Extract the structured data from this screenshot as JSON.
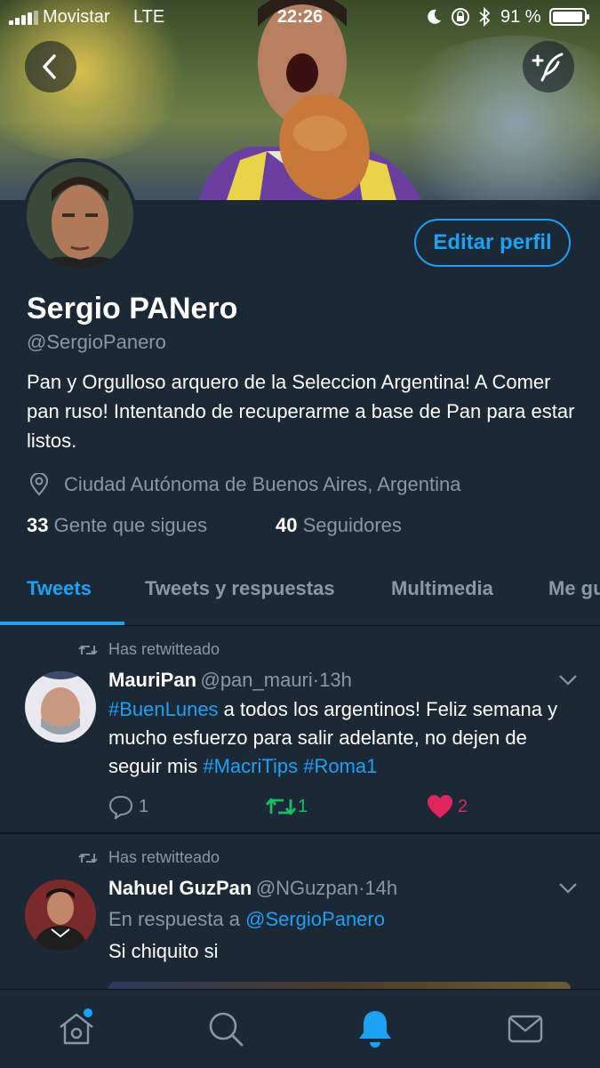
{
  "status_bar": {
    "carrier": "Movistar",
    "network": "LTE",
    "time": "22:26",
    "battery": "91 %"
  },
  "profile": {
    "edit_button": "Editar perfil",
    "name": "Sergio PANero",
    "handle": "@SergioPanero",
    "bio": "Pan y Orgulloso arquero de la Seleccion Argentina! A Comer pan ruso! Intentando de recuperarme a base de Pan para estar listos.",
    "location": "Ciudad Autónoma de Buenos Aires, Argentina",
    "following_count": "33",
    "following_label": "Gente que sigues",
    "followers_count": "40",
    "followers_label": "Seguidores"
  },
  "tabs": [
    {
      "label": "Tweets",
      "active": true
    },
    {
      "label": "Tweets y respuestas",
      "active": false
    },
    {
      "label": "Multimedia",
      "active": false
    },
    {
      "label": "Me gusta",
      "active": false
    }
  ],
  "tweets": [
    {
      "retweet_label": "Has retwitteado",
      "name": "MauriPan",
      "handle": "@pan_mauri",
      "time": "13h",
      "text_parts": [
        "#BuenLunes",
        " a todos los argentinos! Feliz semana y mucho esfuerzo para salir adelante, no dejen de seguir mis ",
        "#MacriTips",
        " ",
        "#Roma1"
      ],
      "replies": "1",
      "retweets": "1",
      "likes": "2"
    },
    {
      "retweet_label": "Has retwitteado",
      "name": "Nahuel GuzPan",
      "handle": "@NGuzpan",
      "time": "14h",
      "reply_prefix": "En respuesta a",
      "reply_to": "@SergioPanero",
      "text": "Si chiquito si"
    }
  ],
  "colors": {
    "accent": "#1da1f2",
    "background": "#141d26",
    "card": "#1b2836",
    "muted": "#8899a6",
    "retweet_green": "#17bf63",
    "like_red": "#e0245e"
  },
  "icons": [
    "back-icon",
    "compose-icon",
    "location-pin-icon",
    "retweet-icon",
    "chevron-down-icon",
    "reply-icon",
    "heart-icon",
    "home-icon",
    "search-icon",
    "notifications-icon",
    "messages-icon"
  ]
}
